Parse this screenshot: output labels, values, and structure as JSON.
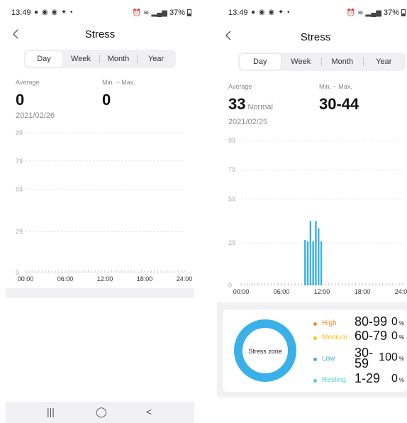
{
  "left": {
    "status": {
      "time": "13:49",
      "notif_icons": "● ◉ ◉ ✦ •",
      "alarm_icon": "alarm-icon",
      "wifi_icon": "wifi-icon",
      "signal_icon": "signal-icon",
      "battery": "37%"
    },
    "title": "Stress",
    "tabs": [
      {
        "label": "Day",
        "active": true
      },
      {
        "label": "Week"
      },
      {
        "label": "Month"
      },
      {
        "label": "Year"
      }
    ],
    "average_label": "Average",
    "average_value": "0",
    "minmax_label": "Min. ~ Max.",
    "minmax_value": "0",
    "date": "2021/02/26",
    "chart_data": {
      "type": "bar",
      "title": "",
      "y_ticks": [
        "99",
        "79",
        "59",
        "29",
        "0"
      ],
      "x_ticks": [
        "00:00",
        "06:00",
        "12:00",
        "18:00",
        "24:00"
      ],
      "ylim": [
        0,
        99
      ],
      "grid": true,
      "values": []
    },
    "bottom_nav": {
      "recent": "|||",
      "home": "◯",
      "back": "<"
    }
  },
  "right": {
    "status": {
      "time": "13:49",
      "notif_icons": "● ◉ ◉ ✦ •",
      "alarm_icon": "alarm-icon",
      "wifi_icon": "wifi-icon",
      "signal_icon": "signal-icon",
      "battery": "37%"
    },
    "title": "Stress",
    "tabs": [
      {
        "label": "Day",
        "active": true
      },
      {
        "label": "Week"
      },
      {
        "label": "Month"
      },
      {
        "label": "Year"
      }
    ],
    "average_label": "Average",
    "average_value": "33",
    "average_status": "Normal",
    "minmax_label": "Min. ~ Max.",
    "minmax_value": "30-44",
    "date": "2021/02/25",
    "chart_data": {
      "type": "bar",
      "title": "",
      "y_ticks": [
        "99",
        "79",
        "59",
        "29",
        "0"
      ],
      "x_ticks": [
        "00:00",
        "06:00",
        "12:00",
        "18:00",
        "24:00"
      ],
      "ylim": [
        0,
        99
      ],
      "grid": true,
      "bar_color": "#3ab0e8",
      "x_hours": [
        9.5,
        9.9,
        10.3,
        10.7,
        11.1,
        11.5,
        11.9
      ],
      "values": [
        31,
        30,
        44,
        30,
        44,
        39,
        30
      ]
    },
    "zone_card": {
      "donut_label": "Stress zone",
      "donut_color": "#3ab0e8",
      "zones": [
        {
          "name": "High",
          "range": "80-99",
          "percent": "0",
          "unit": "%",
          "color": "#f5892f"
        },
        {
          "name": "Medium",
          "range": "60-79",
          "percent": "0",
          "unit": "%",
          "color": "#f5c21b"
        },
        {
          "name": "Low",
          "range": "30-59",
          "percent": "100",
          "unit": "%",
          "color": "#3ab0e8"
        },
        {
          "name": "Resting",
          "range": "1-29",
          "percent": "0",
          "unit": "%",
          "color": "#4fd0d0"
        }
      ]
    }
  }
}
